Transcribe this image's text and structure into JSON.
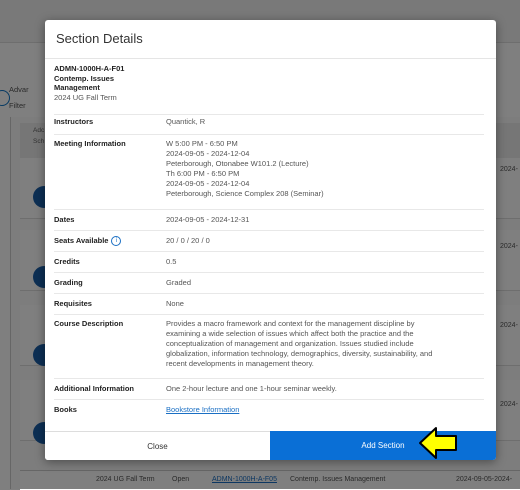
{
  "background": {
    "advanced_label": "Advar",
    "filter_label": "Filter",
    "col_ad": "Adc",
    "col_sc": "Sch",
    "row_dates": [
      "2024-",
      "2024-",
      "2024-",
      "2024-"
    ],
    "bottom_row": {
      "term": "2024 UG Fall Term",
      "status": "Open",
      "code": "ADMN-1000H-A-F05",
      "title": "Contemp. Issues Management",
      "date": "2024-09-05-2024-"
    }
  },
  "modal": {
    "title": "Section Details",
    "course": {
      "code": "ADMN-1000H-A-F01",
      "name_lines": [
        "Contemp. Issues",
        "Management"
      ],
      "term": "2024 UG Fall Term"
    },
    "details": [
      {
        "label": "Instructors",
        "lines": [
          "Quantick, R"
        ]
      },
      {
        "label": "Meeting Information",
        "lines": [
          "W 5:00 PM - 6:50 PM",
          "2024-09-05 - 2024-12-04",
          "Peterborough, Otonabee W101.2 (Lecture)",
          "Th 6:00 PM - 6:50 PM",
          "2024-09-05 - 2024-12-04",
          "Peterborough, Science Complex 208 (Seminar)"
        ]
      },
      {
        "label": "Dates",
        "lines": [
          "2024-09-05 - 2024-12-31"
        ]
      },
      {
        "label": "Seats Available",
        "lines": [
          "20 / 0 / 20 / 0"
        ]
      },
      {
        "label": "Credits",
        "lines": [
          "0.5"
        ]
      },
      {
        "label": "Grading",
        "lines": [
          "Graded"
        ]
      },
      {
        "label": "Requisites",
        "lines": [
          "None"
        ]
      },
      {
        "label": "Course Description",
        "lines": [
          "Provides a macro framework and context for the management discipline by",
          "examining a wide selection of issues which affect both the practice and the",
          "conceptualization of management and organization. Issues studied include",
          "globalization, information technology, demographics, diversity, sustainability, and",
          "recent developments in management theory."
        ]
      },
      {
        "label": "Additional Information",
        "lines": [
          "One 2-hour lecture and one 1-hour seminar weekly."
        ]
      },
      {
        "label": "Books",
        "lines": [
          "Bookstore Information"
        ]
      }
    ],
    "close_label": "Close",
    "add_label": "Add Section",
    "info_glyph": "i"
  },
  "colors": {
    "primary": "#0a6fd6",
    "link": "#1a6fc4",
    "arrow_fill": "#ffff00"
  }
}
